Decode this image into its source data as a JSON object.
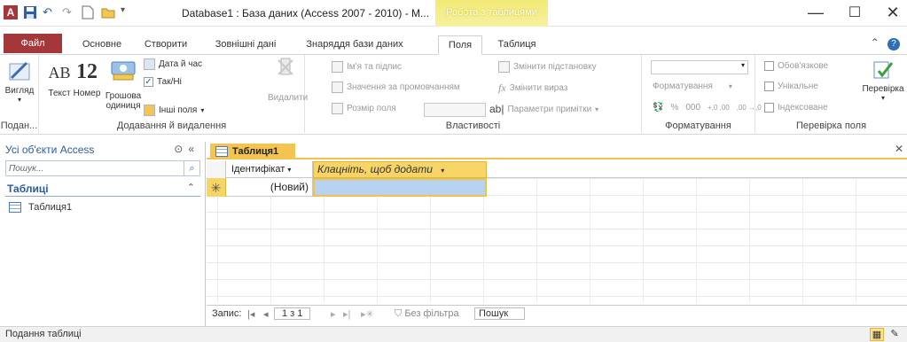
{
  "window": {
    "title": "Database1 : База даних (Access 2007 - 2010) - M...",
    "context_tab_group": "Робота з таблицями",
    "controls": {
      "minimize": "—",
      "maximize": "☐",
      "close": "✕"
    }
  },
  "ribbon_tabs": [
    {
      "label": "Файл",
      "active": false
    },
    {
      "label": "Основне",
      "active": false
    },
    {
      "label": "Створити",
      "active": false
    },
    {
      "label": "Зовнішні дані",
      "active": false
    },
    {
      "label": "Знаряддя бази даних",
      "active": false
    },
    {
      "label": "Поля",
      "active": true
    },
    {
      "label": "Таблиця",
      "active": false
    }
  ],
  "ribbon": {
    "view": {
      "label": "Вигляд",
      "group": "Подан..."
    },
    "add_delete": {
      "group": "Додавання й видалення",
      "text_icon": "AB",
      "number_icon": "12",
      "text": "Текст",
      "number": "Номер",
      "currency_line1": "Грошова",
      "currency_line2": "одиниця",
      "datetime": "Дата й час",
      "yesno": "Так/Ні",
      "more_fields": "Інші поля",
      "delete": "Видалити"
    },
    "properties": {
      "group": "Властивості",
      "name_caption": "Ім'я та підпис",
      "default_value": "Значення за промовчанням",
      "field_size": "Розмір поля",
      "change_lookup": "Змінити підстановку",
      "change_expression": "Змінити вираз",
      "memo_settings": "Параметри примітки"
    },
    "formatting": {
      "group": "Форматування",
      "format_combo": "Форматування",
      "percent": "%",
      "thousands": "000",
      "inc_decimals": "+,0 ,00",
      "dec_decimals": ",00 →,0"
    },
    "validation": {
      "group": "Перевірка поля",
      "required": "Обов'язкове",
      "unique": "Унікальне",
      "indexed": "Індексоване",
      "validate": "Перевірка"
    }
  },
  "nav_pane": {
    "header": "Усі об'єкти Access",
    "search_placeholder": "Пошук...",
    "group": "Таблиці",
    "items": [
      {
        "label": "Таблиця1"
      }
    ]
  },
  "document": {
    "tab_label": "Таблиця1",
    "close": "✕",
    "columns": [
      "Ідентифікат",
      "Клацніть, щоб додати"
    ],
    "new_row_marker": "✳",
    "new_row_id": "(Новий)"
  },
  "record_nav": {
    "label": "Запис:",
    "first": "|◂",
    "prev": "◂",
    "position": "1 з 1",
    "next": "▸",
    "last": "▸|",
    "new": "▸✳",
    "filter": "Без фільтра",
    "search": "Пошук"
  },
  "status": {
    "text": "Подання таблиці"
  }
}
